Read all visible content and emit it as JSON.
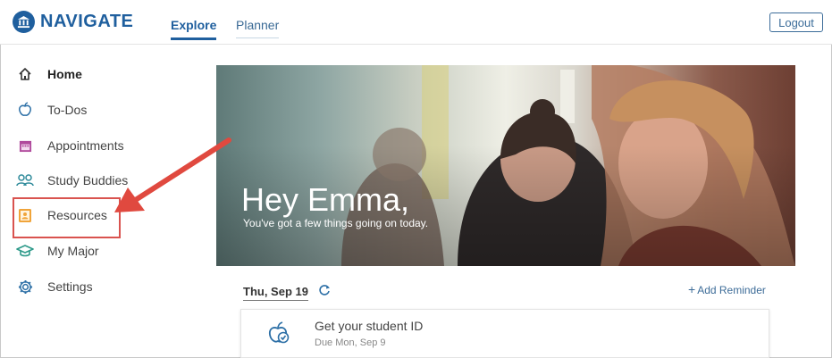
{
  "app": {
    "name": "NAVIGATE"
  },
  "header": {
    "tabs": [
      {
        "label": "Explore",
        "active": true
      },
      {
        "label": "Planner",
        "active": false
      }
    ],
    "logout_label": "Logout"
  },
  "sidebar": {
    "items": [
      {
        "label": "Home",
        "icon": "home-icon"
      },
      {
        "label": "To-Dos",
        "icon": "apple-icon"
      },
      {
        "label": "Appointments",
        "icon": "calendar-icon"
      },
      {
        "label": "Study Buddies",
        "icon": "people-icon"
      },
      {
        "label": "Resources",
        "icon": "contact-card-icon"
      },
      {
        "label": "My Major",
        "icon": "graduation-cap-icon"
      },
      {
        "label": "Settings",
        "icon": "gear-icon"
      }
    ],
    "highlighted": "Resources"
  },
  "hero": {
    "greeting": "Hey Emma,",
    "subtitle": "You've got a few things going on today."
  },
  "schedule": {
    "date": "Thu, Sep 19",
    "add_reminder_label": "Add Reminder"
  },
  "todo": {
    "title": "Get your student ID",
    "due": "Due Mon, Sep 9"
  },
  "colors": {
    "brand": "#1f5f9e",
    "annotation": "#d9534f"
  }
}
